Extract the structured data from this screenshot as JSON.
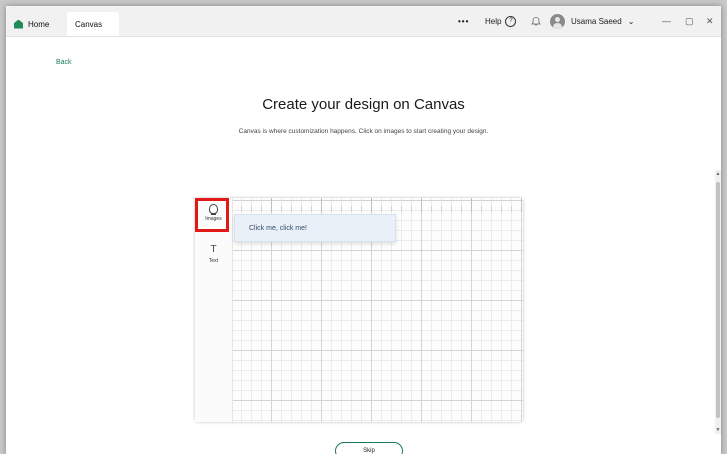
{
  "titlebar": {
    "tabs": [
      {
        "label": "Home",
        "icon": "home-icon"
      },
      {
        "label": "Canvas"
      }
    ],
    "more_label": "•••",
    "help_label": "Help",
    "help_icon_glyph": "?",
    "bell_glyph": "🔔",
    "user_name": "Usama Saeed",
    "user_chevron": "⌄",
    "window_controls": {
      "minimize": "—",
      "maximize": "▢",
      "close": "✕"
    }
  },
  "page": {
    "back_label": "Back",
    "heading": "Create your design on Canvas",
    "subtitle": "Canvas is where customization happens. Click on images to start creating your design."
  },
  "editor": {
    "side_items": [
      {
        "label": "Images",
        "icon": "lightbulb-icon"
      },
      {
        "label": "Text",
        "icon": "text-icon",
        "glyph": "T"
      }
    ],
    "tooltip": "Click me, click me!"
  },
  "footer": {
    "skip_label": "Skip"
  },
  "colors": {
    "accent": "#1f7a55",
    "highlight": "#e01818",
    "tooltip_bg": "#eaf0f8"
  }
}
